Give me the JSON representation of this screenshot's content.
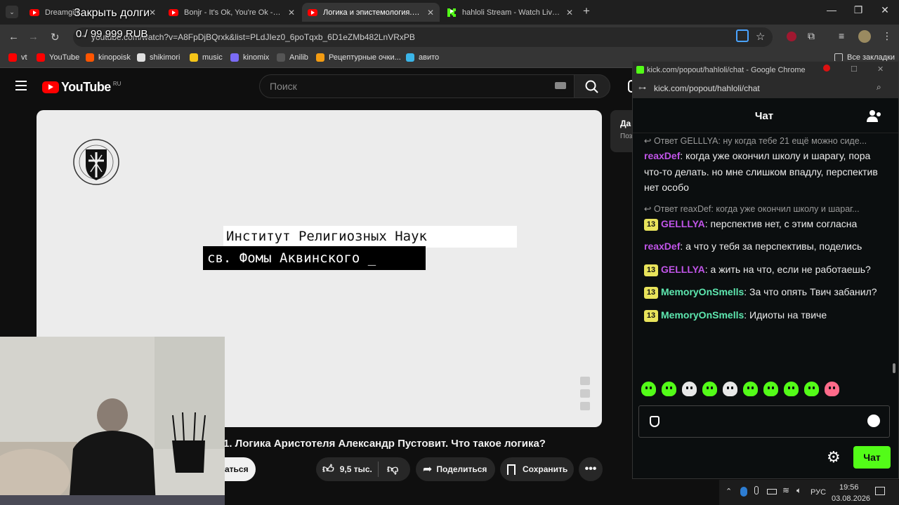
{
  "stream_overlay": {
    "goal_title": "Закрыть долги",
    "goal_progress": "0 / 99 999 RUB"
  },
  "browser": {
    "tabs": [
      {
        "title": "Dreamgirl",
        "favicon": "youtube-icon"
      },
      {
        "title": "Bonjr - It's Ok, You're Ok - YouT",
        "favicon": "youtube-icon"
      },
      {
        "title": "Логика и эпистемология. Лекц",
        "favicon": "youtube-icon",
        "active": true
      },
      {
        "title": "hahloli Stream - Watch Live on",
        "favicon": "kick-icon"
      }
    ],
    "url": "youtube.com/watch?v=A8FpDjBQrxk&list=PLdJIez0_6poTqxb_6D1eZMb482LnVRxPB",
    "bookmarks": [
      {
        "label": "vt",
        "icon": "youtube-icon",
        "color": "#ff0000"
      },
      {
        "label": "YouTube",
        "icon": "youtube-icon",
        "color": "#ff0000"
      },
      {
        "label": "kinopoisk",
        "icon": "kinopoisk-icon",
        "color": "#ff5500"
      },
      {
        "label": "shikimori",
        "icon": "shikimori-icon",
        "color": "#e0e0e0"
      },
      {
        "label": "music",
        "icon": "sun-icon",
        "color": "#f5c518"
      },
      {
        "label": "kinomix",
        "icon": "play-triangle-icon",
        "color": "#7b6cf6"
      },
      {
        "label": "Anilib",
        "icon": "anilib-icon",
        "color": "#555555"
      },
      {
        "label": "Рецептурные очки...",
        "icon": "glasses-icon",
        "color": "#f39c12"
      },
      {
        "label": "авито",
        "icon": "avito-icon",
        "color": "#3bb5e8"
      }
    ],
    "all_bookmarks_label": "Все закладки"
  },
  "youtube": {
    "logo_text": "YouTube",
    "region": "RU",
    "search_placeholder": "Поиск",
    "video": {
      "slide_line1": "Институт Религиозных Наук",
      "slide_line2": "св. Фомы Аквинского _",
      "title": "1. Логика Аристотеля Александр Пустовит. Что такое логика?",
      "subscribe_partial": "аться",
      "like_count": "9,5 тыс.",
      "share_label": "Поделиться",
      "save_label": "Сохранить"
    },
    "side_peek_title": "Да",
    "side_peek_sub": "Поз"
  },
  "chat_window": {
    "window_title": "kick.com/popout/hahloli/chat - Google Chrome",
    "address": "kick.com/popout/hahloli/chat",
    "header": "Чат",
    "messages": [
      {
        "type": "reply",
        "text": "Ответ GELLLYA: ну когда тебе 21 ещё можно сиде..."
      },
      {
        "type": "msg",
        "badge": "",
        "user": "reaxDef",
        "color": "#c054e8",
        "text": "когда уже окончил школу и шарагу, пора что-то делать. но мне слишком впадлу, перспектив нет особо"
      },
      {
        "type": "reply",
        "text": "Ответ reaxDef: когда уже окончил школу и шараг..."
      },
      {
        "type": "msg",
        "badge": "13",
        "user": "GELLLYA",
        "color": "#c054e8",
        "text": "перспектив нет, с этим согласна"
      },
      {
        "type": "msg",
        "badge": "",
        "user": "reaxDef",
        "color": "#c054e8",
        "text": "а что у тебя за перспективы, поделись"
      },
      {
        "type": "msg",
        "badge": "13",
        "user": "GELLLYA",
        "color": "#c054e8",
        "text": "а жить на что, если не работаешь?"
      },
      {
        "type": "msg",
        "badge": "13",
        "user": "MemoryOnSmells",
        "color": "#5ee8b0",
        "text": "За что опять Твич забанил?"
      },
      {
        "type": "msg",
        "badge": "13",
        "user": "MemoryOnSmells",
        "color": "#5ee8b0",
        "text": "Идиоты на твиче"
      }
    ],
    "send_label": "Чат",
    "accent": "#53fc18"
  },
  "taskbar": {
    "language": "РУС",
    "time": "19:56",
    "date": "03.08.2026"
  }
}
